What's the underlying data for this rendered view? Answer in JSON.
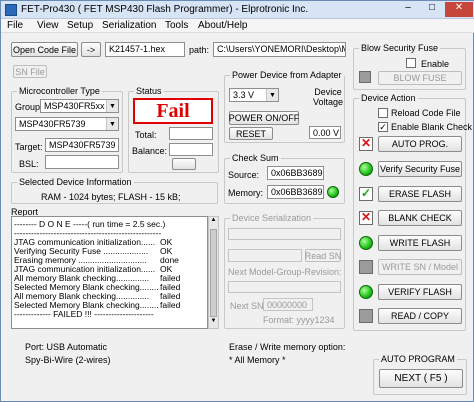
{
  "window": {
    "title": "FET-Pro430   ( FET MSP430 Flash Programmer)   -   Elprotronic Inc.",
    "controls": {
      "minimize": "–",
      "maximize": "□",
      "close": "✕"
    }
  },
  "menu": [
    "File",
    "View",
    "Setup",
    "Serialization",
    "Tools",
    "About/Help"
  ],
  "file": {
    "open_button": "Open Code File",
    "arrow_button": "->",
    "filename": "K21457-1.hex",
    "path_label": "path:",
    "path": "C:\\Users\\YONEMORI\\Desktop\\MX",
    "sn_file_button": "SN File"
  },
  "microcontroller": {
    "title": "Microcontroller Type",
    "group_label": "Group:",
    "group_value": "MSP430FR5xx",
    "device_value": "MSP430FR5739",
    "target_label": "Target:",
    "target_value": "MSP430FR5739",
    "bsl_label": "BSL:",
    "bsl_value": ""
  },
  "status": {
    "title": "Status",
    "result": "Fail",
    "total_label": "Total:",
    "total_value": "",
    "balance_label": "Balance:",
    "balance_value": ""
  },
  "power": {
    "title": "Power Device from Adapter",
    "voltage": "3.3 V",
    "device_voltage_label": "Device\nVoltage",
    "on_off_button": "POWER ON/OFF",
    "reset_button": "RESET",
    "measured": "0.00 V"
  },
  "checksum": {
    "title": "Check Sum",
    "source_label": "Source:",
    "source_value": "0x06BB3689",
    "memory_label": "Memory:",
    "memory_value": "0x06BB3689"
  },
  "device_info": {
    "title": "Selected Device Information",
    "text": "RAM  -  1024 bytes;     FLASH - 15 kB;"
  },
  "report": {
    "title": "Report",
    "lines": [
      {
        "text": "-------- D O N E -----( run time =  2.5 sec.)",
        "status": ""
      },
      {
        "text": "----------------------------------------------------",
        "status": ""
      },
      {
        "text": "JTAG communication initialization......",
        "status": "OK"
      },
      {
        "text": "Verifying Security Fuse ...................",
        "status": "OK"
      },
      {
        "text": "Erasing memory .............................",
        "status": "done"
      },
      {
        "text": "JTAG communication initialization......",
        "status": "OK"
      },
      {
        "text": "All memory Blank checking..............",
        "status": "failed"
      },
      {
        "text": "Selected Memory Blank checking........",
        "status": "failed"
      },
      {
        "text": "All memory Blank checking..............",
        "status": "failed"
      },
      {
        "text": "Selected Memory Blank checking........",
        "status": "failed"
      },
      {
        "text": "------------- FAILED !!! ---------------------",
        "status": ""
      }
    ]
  },
  "serialization": {
    "title": "Device Serialization",
    "read_sn_button": "Read SN",
    "next_model_label": "Next Model-Group-Revision:",
    "next_sn_label": "Next SN:",
    "next_sn_value": "00000000",
    "format_label": "Format: yyyy1234"
  },
  "blow_fuse": {
    "title": "Blow Security Fuse",
    "enable_label": "Enable",
    "button": "BLOW FUSE"
  },
  "device_action": {
    "title": "Device Action",
    "reload_label": "Reload Code File",
    "blank_check_label": "Enable Blank Check",
    "buttons": [
      "AUTO PROG.",
      "Verify Security Fuse",
      "ERASE FLASH",
      "BLANK CHECK",
      "WRITE FLASH",
      "WRITE SN / Model",
      "VERIFY FLASH",
      "READ / COPY"
    ]
  },
  "bottom": {
    "port": "Port: USB Automatic",
    "interface": "Spy-Bi-Wire (2-wires)",
    "erase_option": "Erase / Write memory option:",
    "erase_value": "* All Memory *",
    "auto_program_title": "AUTO PROGRAM",
    "next_button": "NEXT  ( F5 )"
  },
  "colors": {
    "fail_red": "#e00000",
    "accent_green": "#1fbf18"
  }
}
